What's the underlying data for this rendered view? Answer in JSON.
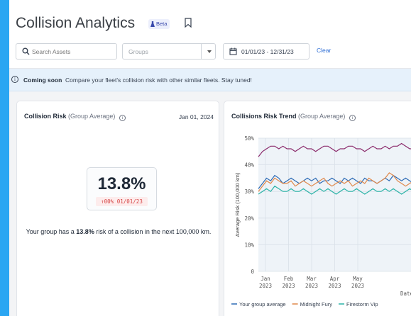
{
  "header": {
    "title": "Collision Analytics",
    "beta_label": "Beta",
    "bookmark_icon": "bookmark-icon"
  },
  "filters": {
    "search_placeholder": "Search Assets",
    "groups_placeholder": "Groups",
    "date_range": "01/01/23 - 12/31/23",
    "clear_label": "Clear"
  },
  "banner": {
    "lead": "Coming soon",
    "text": "Compare your fleet's collision risk with other similar fleets. Stay tuned!"
  },
  "risk_card": {
    "title": "Collision Risk",
    "subtitle": "(Group Average)",
    "date": "Jan 01, 2024",
    "value": "13.8%",
    "change": "↑00% 01/01/23",
    "desc_before": "Your group has a ",
    "desc_value": "13.8%",
    "desc_after": " risk of a collision in the next 100,000 km."
  },
  "trend_card": {
    "title": "Collisions Risk Trend",
    "subtitle": "(Group Average)"
  },
  "colors": {
    "accent": "#2f6fd6",
    "frame_bg": "#2aa6f2",
    "series_purple": "#8b2a6b",
    "series_blue": "#2d6bb5",
    "series_orange": "#e0884a",
    "series_teal": "#2bb3a7"
  },
  "chart_data": {
    "type": "line",
    "ylabel": "Average Risk (100,000 km)",
    "xlabel": "Date",
    "ylim": [
      0,
      50
    ],
    "y_ticks": [
      "0",
      "10%",
      "20%",
      "30%",
      "40%",
      "50%"
    ],
    "x_ticks": [
      {
        "month": "Jan",
        "year": "2023"
      },
      {
        "month": "Feb",
        "year": "2023"
      },
      {
        "month": "Mar",
        "year": "2023"
      },
      {
        "month": "Apr",
        "year": "2023"
      },
      {
        "month": "May",
        "year": "2023"
      }
    ],
    "grid": true,
    "legend": "bottom",
    "series": [
      {
        "name": "",
        "color": "#8b2a6b",
        "values": [
          43,
          45,
          46,
          47,
          47,
          46,
          47,
          46,
          46,
          45,
          46,
          47,
          46,
          46,
          45,
          46,
          47,
          47,
          46,
          45,
          46,
          46,
          47,
          47,
          46,
          46,
          45,
          46,
          47,
          46,
          46,
          47,
          46,
          47,
          47,
          48,
          47,
          46,
          46,
          47,
          46,
          47,
          46
        ]
      },
      {
        "name": "Your group average",
        "color": "#2d6bb5",
        "values": [
          31,
          33,
          35,
          34,
          36,
          35,
          33,
          34,
          35,
          34,
          33,
          34,
          35,
          34,
          35,
          33,
          34,
          34,
          35,
          34,
          33,
          35,
          34,
          35,
          34,
          33,
          35,
          34,
          34,
          33,
          34,
          35,
          34,
          36,
          35,
          34,
          35,
          34,
          33,
          34,
          35,
          34,
          34
        ]
      },
      {
        "name": "Midnight Fury",
        "color": "#e0884a",
        "values": [
          30,
          32,
          34,
          33,
          35,
          34,
          33,
          33,
          34,
          32,
          33,
          34,
          33,
          32,
          33,
          34,
          35,
          33,
          32,
          33,
          34,
          33,
          34,
          32,
          33,
          34,
          33,
          35,
          34,
          33,
          34,
          35,
          37,
          36,
          34,
          33,
          32,
          33,
          34,
          33,
          34,
          33,
          34
        ]
      },
      {
        "name": "Firestorm Vip",
        "color": "#2bb3a7",
        "values": [
          29,
          30,
          31,
          30,
          32,
          31,
          30,
          30,
          31,
          30,
          30,
          31,
          30,
          29,
          30,
          31,
          30,
          31,
          30,
          29,
          30,
          31,
          30,
          30,
          31,
          30,
          29,
          30,
          31,
          30,
          30,
          31,
          30,
          31,
          30,
          29,
          30,
          31,
          30,
          30,
          31,
          30,
          30
        ]
      }
    ]
  }
}
